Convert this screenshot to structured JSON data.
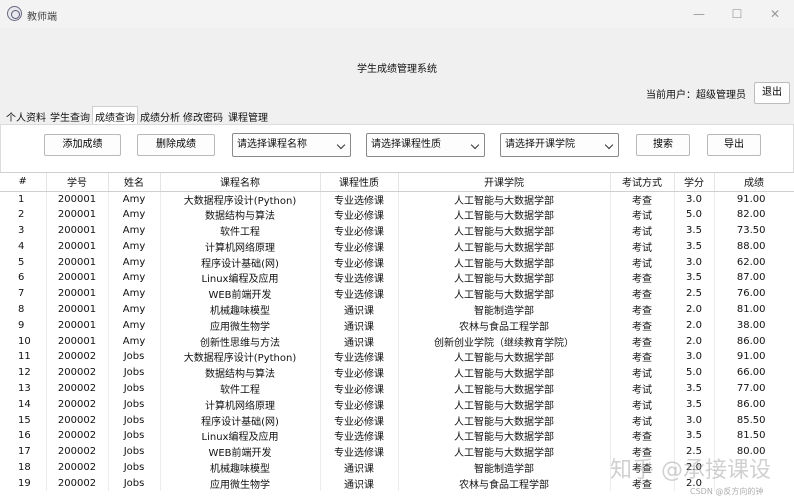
{
  "window": {
    "title": "教师端",
    "min_icon": "—",
    "max_icon": "☐",
    "close_icon": "✕"
  },
  "header": {
    "system_title": "学生成绩管理系统",
    "current_user": "当前用户：超级管理员",
    "logout_label": "退出"
  },
  "tabs": [
    {
      "label": "个人资料"
    },
    {
      "label": "学生查询"
    },
    {
      "label": "成绩查询",
      "active": true
    },
    {
      "label": "成绩分析"
    },
    {
      "label": "修改密码"
    },
    {
      "label": "课程管理"
    }
  ],
  "toolbar": {
    "add_label": "添加成绩",
    "delete_label": "删除成绩",
    "course_select": "请选择课程名称",
    "nature_select": "请选择课程性质",
    "college_select": "请选择开课学院",
    "search_label": "搜索",
    "export_label": "导出"
  },
  "table": {
    "columns": [
      "#",
      "学号",
      "姓名",
      "课程名称",
      "课程性质",
      "开课学院",
      "考试方式",
      "学分",
      "成绩"
    ],
    "rows": [
      [
        "1",
        "200001",
        "Amy",
        "大数据程序设计(Python)",
        "专业选修课",
        "人工智能与大数据学部",
        "考查",
        "3.0",
        "91.00"
      ],
      [
        "2",
        "200001",
        "Amy",
        "数据结构与算法",
        "专业必修课",
        "人工智能与大数据学部",
        "考试",
        "5.0",
        "82.00"
      ],
      [
        "3",
        "200001",
        "Amy",
        "软件工程",
        "专业必修课",
        "人工智能与大数据学部",
        "考试",
        "3.5",
        "73.50"
      ],
      [
        "4",
        "200001",
        "Amy",
        "计算机网络原理",
        "专业必修课",
        "人工智能与大数据学部",
        "考试",
        "3.5",
        "88.00"
      ],
      [
        "5",
        "200001",
        "Amy",
        "程序设计基础(网)",
        "专业必修课",
        "人工智能与大数据学部",
        "考试",
        "3.0",
        "62.00"
      ],
      [
        "6",
        "200001",
        "Amy",
        "Linux编程及应用",
        "专业选修课",
        "人工智能与大数据学部",
        "考查",
        "3.5",
        "87.00"
      ],
      [
        "7",
        "200001",
        "Amy",
        "WEB前端开发",
        "专业选修课",
        "人工智能与大数据学部",
        "考查",
        "2.5",
        "76.00"
      ],
      [
        "8",
        "200001",
        "Amy",
        "机械趣味模型",
        "通识课",
        "智能制造学部",
        "考查",
        "2.0",
        "81.00"
      ],
      [
        "9",
        "200001",
        "Amy",
        "应用微生物学",
        "通识课",
        "农林与食品工程学部",
        "考查",
        "2.0",
        "38.00"
      ],
      [
        "10",
        "200001",
        "Amy",
        "创新性思维与方法",
        "通识课",
        "创新创业学院（继续教育学院）",
        "考查",
        "2.0",
        "86.00"
      ],
      [
        "11",
        "200002",
        "Jobs",
        "大数据程序设计(Python)",
        "专业选修课",
        "人工智能与大数据学部",
        "考查",
        "3.0",
        "91.00"
      ],
      [
        "12",
        "200002",
        "Jobs",
        "数据结构与算法",
        "专业必修课",
        "人工智能与大数据学部",
        "考试",
        "5.0",
        "66.00"
      ],
      [
        "13",
        "200002",
        "Jobs",
        "软件工程",
        "专业必修课",
        "人工智能与大数据学部",
        "考试",
        "3.5",
        "77.00"
      ],
      [
        "14",
        "200002",
        "Jobs",
        "计算机网络原理",
        "专业必修课",
        "人工智能与大数据学部",
        "考试",
        "3.5",
        "86.00"
      ],
      [
        "15",
        "200002",
        "Jobs",
        "程序设计基础(网)",
        "专业必修课",
        "人工智能与大数据学部",
        "考试",
        "3.0",
        "85.50"
      ],
      [
        "16",
        "200002",
        "Jobs",
        "Linux编程及应用",
        "专业选修课",
        "人工智能与大数据学部",
        "考查",
        "3.5",
        "81.50"
      ],
      [
        "17",
        "200002",
        "Jobs",
        "WEB前端开发",
        "专业选修课",
        "人工智能与大数据学部",
        "考查",
        "2.5",
        "80.00"
      ],
      [
        "18",
        "200002",
        "Jobs",
        "机械趣味模型",
        "通识课",
        "智能制造学部",
        "考查",
        "2.0",
        ""
      ],
      [
        "19",
        "200002",
        "Jobs",
        "应用微生物学",
        "通识课",
        "农林与食品工程学部",
        "考查",
        "2.0",
        ""
      ]
    ]
  },
  "watermark": {
    "text": "知乎 @承接课设",
    "csdn": "CSDN @反方向的钟"
  }
}
